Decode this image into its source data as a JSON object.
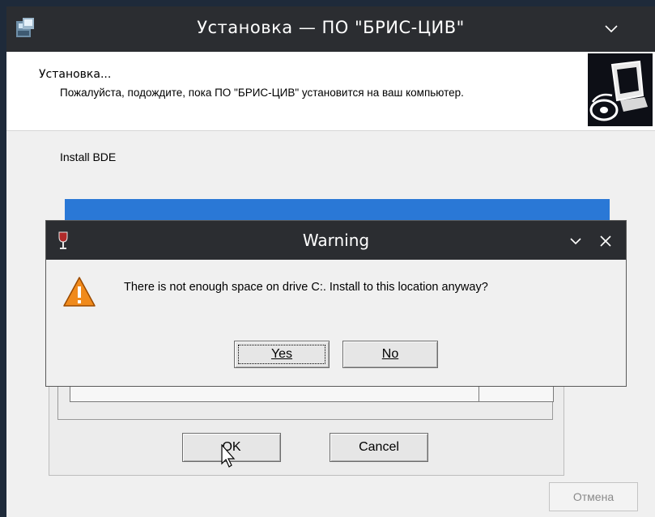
{
  "installer": {
    "title": "Установка — ПО \"БРИС-ЦИВ\"",
    "header_title": "Установка...",
    "header_description": "Пожалуйста, подождите, пока ПО \"БРИС-ЦИВ\" установится на ваш компьютер.",
    "status_text": "Install BDE",
    "progress_fraction": 1.0,
    "cancel_label": "Отмена",
    "icons": [
      "installer-app-icon",
      "chevron-down-icon",
      "computer-disc-logo"
    ]
  },
  "bde_dialog": {
    "ok_label": "OK",
    "cancel_label": "Cancel"
  },
  "warning": {
    "title": "Warning",
    "message": "There is not enough space on drive C:.  Install to this location anyway?",
    "yes_label": "Yes",
    "no_label": "No",
    "icons": [
      "wine-glass-icon",
      "chevron-down-icon",
      "close-icon",
      "warning-triangle-icon"
    ]
  },
  "colors": {
    "titlebar": "#2b2d31",
    "progress": "#2a78d6",
    "warning_icon": "#f08a1c"
  }
}
